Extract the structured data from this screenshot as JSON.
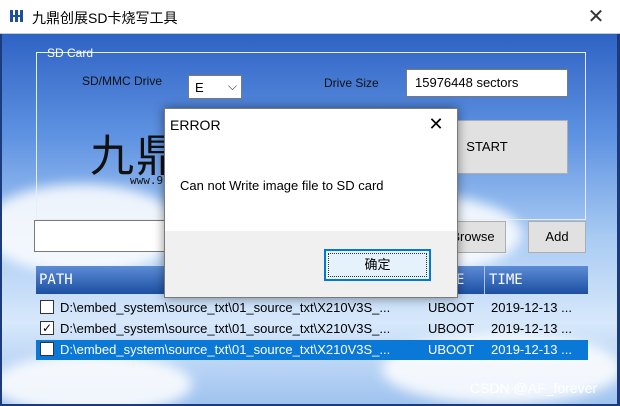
{
  "window": {
    "title": "九鼎创展SD卡烧写工具"
  },
  "sd_card": {
    "group_label": "SD Card",
    "drive_label": "SD/MMC Drive",
    "drive_value": "E",
    "size_label": "Drive Size",
    "size_value": "15976448 sectors",
    "start_label": "START"
  },
  "logo": {
    "text": "九鼎",
    "url": "www.9"
  },
  "file": {
    "path_value": "",
    "browse_label": "Browse",
    "add_label": "Add"
  },
  "list": {
    "headers": {
      "path": "PATH",
      "type": "E",
      "time": "TIME"
    },
    "rows": [
      {
        "checked": false,
        "path": "D:\\embed_system\\source_txt\\01_source_txt\\X210V3S_...",
        "type": "UBOOT",
        "time": "2019-12-13 ..."
      },
      {
        "checked": true,
        "path": "D:\\embed_system\\source_txt\\01_source_txt\\X210V3S_...",
        "type": "UBOOT",
        "time": "2019-12-13 ..."
      },
      {
        "checked": false,
        "path": "D:\\embed_system\\source_txt\\01_source_txt\\X210V3S_...",
        "type": "UBOOT",
        "time": "2019-12-13 ..."
      }
    ]
  },
  "watermark": "CSDN @AF_forever",
  "dialog": {
    "title": "ERROR",
    "message": "Can not Write image file to SD card",
    "ok_label": "确定"
  },
  "icons": {
    "app": "app-logo-icon",
    "close": "close-icon",
    "dropdown": "chevron-down-icon",
    "check": "checkmark-icon"
  },
  "colors": {
    "selection": "#0a78d7",
    "header": "#1c4fa3",
    "ok_border": "#0078d7"
  }
}
